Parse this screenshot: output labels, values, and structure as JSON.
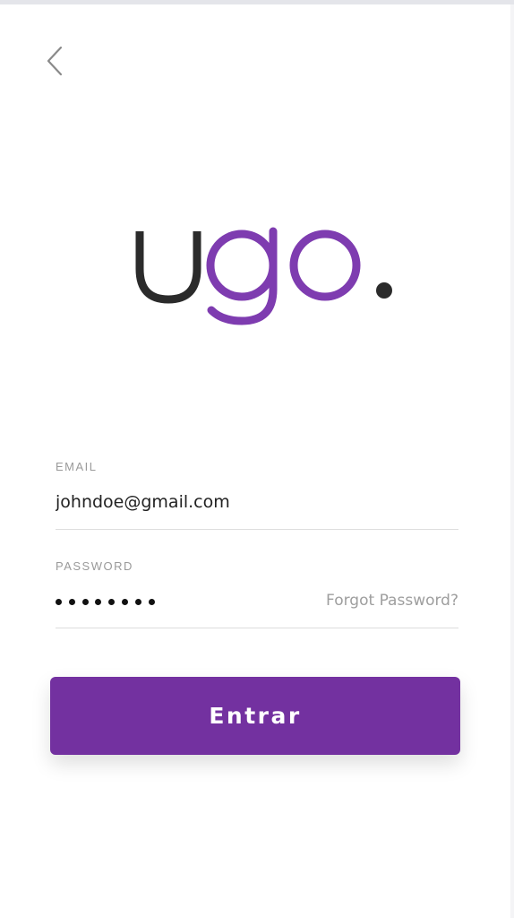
{
  "header": {
    "back_icon": "chevron-left-icon"
  },
  "logo": {
    "text": "ugo.",
    "colors": {
      "u": "#2b2b2b",
      "go": "#7e3cb0",
      "dot": "#2b2b2b"
    }
  },
  "form": {
    "email": {
      "label": "EMAIL",
      "value": "johndoe@gmail.com"
    },
    "password": {
      "label": "PASSWORD",
      "masked_length": 8,
      "forgot_label": "Forgot Password?"
    },
    "submit_label": "Entrar"
  },
  "colors": {
    "accent": "#7331a0",
    "muted_text": "#9e9e9e",
    "divider": "#dddddd"
  }
}
